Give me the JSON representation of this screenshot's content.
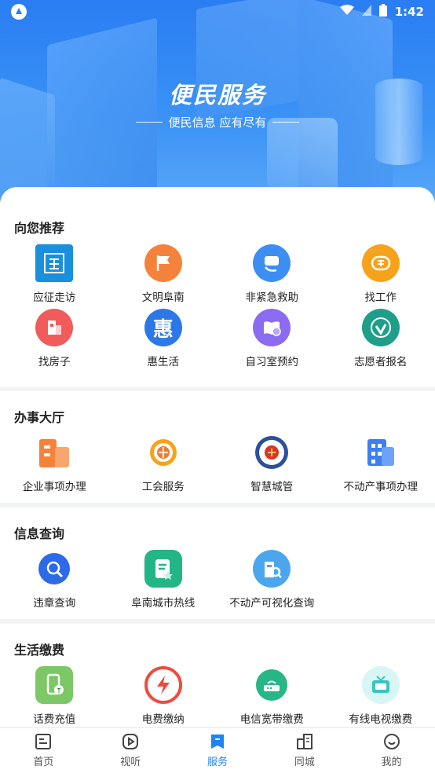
{
  "status_bar": {
    "time": "1:42"
  },
  "hero": {
    "title": "便民服务",
    "subtitle": "便民信息 应有尽有"
  },
  "sections": {
    "recommend": {
      "title": "向您推荐",
      "items": [
        {
          "label": "应征走访",
          "icon": "zheng-icon",
          "color": "#1a8fdc"
        },
        {
          "label": "文明阜南",
          "icon": "flag-icon",
          "color": "#f5823b"
        },
        {
          "label": "非紧急救助",
          "icon": "phone-icon",
          "color": "#3d8ef2"
        },
        {
          "label": "找工作",
          "icon": "hire-icon",
          "color": "#f7a21b"
        },
        {
          "label": "找房子",
          "icon": "house-icon",
          "color": "#f05b5b"
        },
        {
          "label": "惠生活",
          "icon": "hui-icon",
          "color": "#2d77e8"
        },
        {
          "label": "自习室预约",
          "icon": "book-icon",
          "color": "#8b6bf0"
        },
        {
          "label": "志愿者报名",
          "icon": "volunteer-icon",
          "color": "#1f9e8a"
        }
      ]
    },
    "hall": {
      "title": "办事大厅",
      "items": [
        {
          "label": "企业事项办理",
          "icon": "building-orange-icon",
          "color": "#f5823b"
        },
        {
          "label": "工会服务",
          "icon": "union-icon",
          "color": "#f07a2a"
        },
        {
          "label": "智慧城管",
          "icon": "emblem-icon",
          "color": "#2a4f9b"
        },
        {
          "label": "不动产事项办理",
          "icon": "building-blue-icon",
          "color": "#3d7ff2"
        }
      ]
    },
    "query": {
      "title": "信息查询",
      "items": [
        {
          "label": "违章查询",
          "icon": "violation-icon",
          "color": "#2d6ae8"
        },
        {
          "label": "阜南城市热线",
          "icon": "hotline-icon",
          "color": "#22b585"
        },
        {
          "label": "不动产可视化查询",
          "icon": "property-icon",
          "color": "#4ba6ee"
        }
      ]
    },
    "payment": {
      "title": "生活缴费",
      "items": [
        {
          "label": "话费充值",
          "icon": "mobile-icon",
          "color": "#7cc766"
        },
        {
          "label": "电费缴纳",
          "icon": "electricity-icon",
          "color": "#ef4b3f"
        },
        {
          "label": "电信宽带缴费",
          "icon": "broadband-icon",
          "color": "#27b686"
        },
        {
          "label": "有线电视缴费",
          "icon": "tv-icon",
          "color": "#38c5c2"
        }
      ]
    }
  },
  "tabbar": {
    "tabs": [
      {
        "label": "首页",
        "icon": "home-icon"
      },
      {
        "label": "视听",
        "icon": "play-icon"
      },
      {
        "label": "服务",
        "icon": "service-icon"
      },
      {
        "label": "同城",
        "icon": "city-icon"
      },
      {
        "label": "我的",
        "icon": "profile-icon"
      }
    ],
    "active": "服务"
  }
}
